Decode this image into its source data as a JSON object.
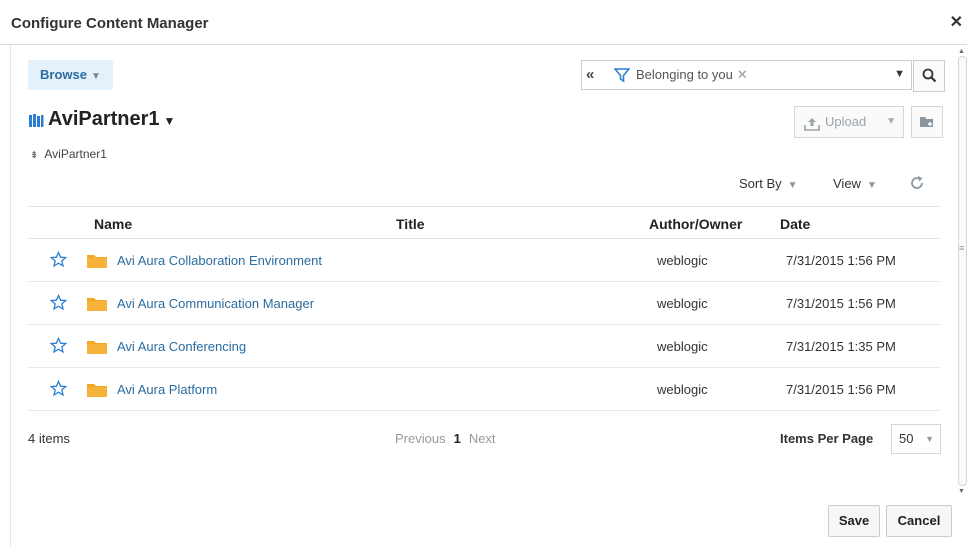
{
  "dialog": {
    "title": "Configure Content Manager"
  },
  "toolbar": {
    "browse_label": "Browse",
    "filter_chip": "Belonging to you",
    "upload_label": "Upload"
  },
  "location": {
    "title": "AviPartner1",
    "breadcrumb": "AviPartner1"
  },
  "view_controls": {
    "sort_by": "Sort By",
    "view": "View"
  },
  "table": {
    "columns": {
      "name": "Name",
      "title": "Title",
      "author": "Author/Owner",
      "date": "Date"
    },
    "rows": [
      {
        "name": "Avi Aura Collaboration Environment",
        "title": "",
        "author": "weblogic",
        "date": "7/31/2015 1:56 PM"
      },
      {
        "name": "Avi Aura Communication Manager",
        "title": "",
        "author": "weblogic",
        "date": "7/31/2015 1:56 PM"
      },
      {
        "name": "Avi Aura Conferencing",
        "title": "",
        "author": "weblogic",
        "date": "7/31/2015 1:35 PM"
      },
      {
        "name": "Avi Aura Platform",
        "title": "",
        "author": "weblogic",
        "date": "7/31/2015 1:56 PM"
      }
    ]
  },
  "footer": {
    "count": "4 items",
    "previous": "Previous",
    "current_page": "1",
    "next": "Next",
    "items_per_page_label": "Items Per Page",
    "items_per_page_value": "50"
  },
  "actions": {
    "save": "Save",
    "cancel": "Cancel"
  },
  "colors": {
    "link": "#2a6ca0",
    "folder": "#f5a623",
    "star": "#2a7fd0",
    "browse_bg": "#e4f0fa"
  }
}
